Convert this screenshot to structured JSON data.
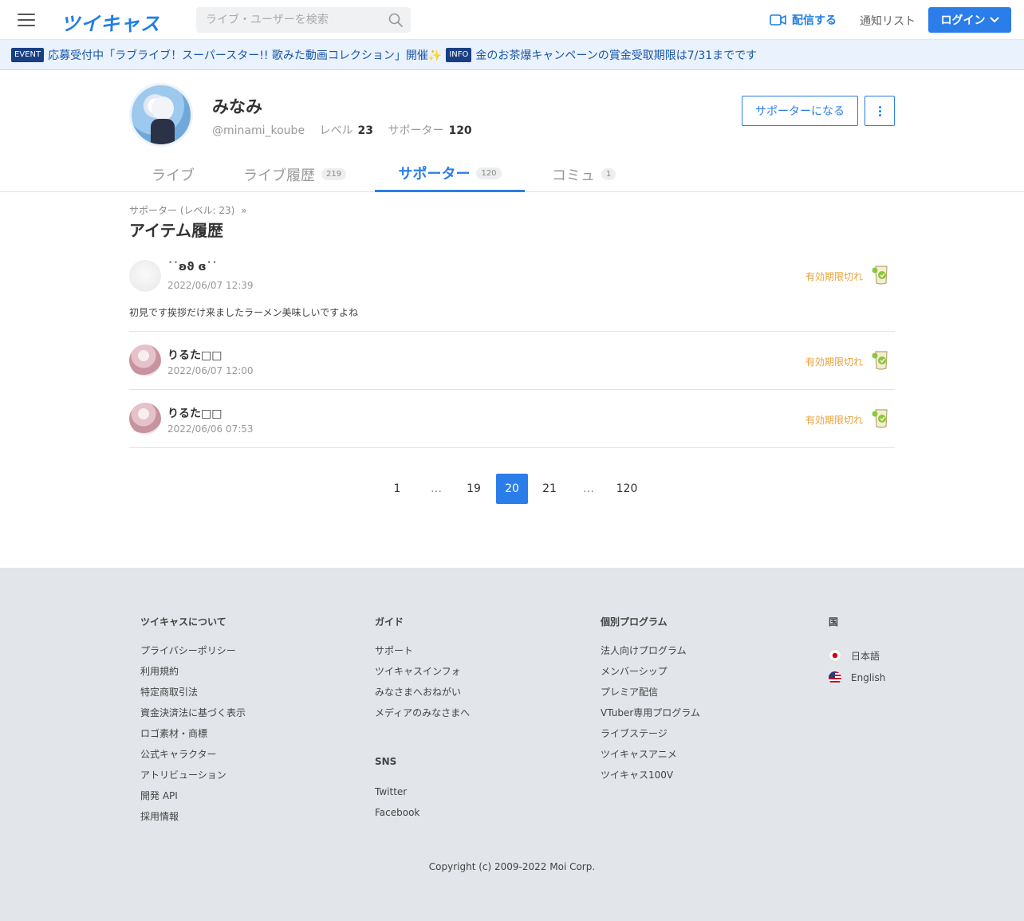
{
  "header": {
    "logo": "ツイキャス",
    "search_placeholder": "ライブ・ユーザーを検索",
    "broadcast_label": "配信する",
    "notify_label": "通知リスト",
    "login_label": "ログイン"
  },
  "infobar": {
    "event_tag": "EVENT",
    "event_text": "応募受付中「ラブライブ！スーパースター!! 歌みた動画コレクション」開催✨",
    "info_tag": "INFO",
    "info_text": "金のお茶爆キャンペーンの賞金受取期限は7/31までです"
  },
  "profile": {
    "name": "みなみ",
    "handle": "@minami_koube",
    "level_label": "レベル",
    "level_value": "23",
    "supporter_label": "サポーター",
    "supporter_value": "120",
    "become_supporter_label": "サポーターになる"
  },
  "tabs": [
    {
      "label": "ライブ",
      "count": ""
    },
    {
      "label": "ライブ履歴",
      "count": "219"
    },
    {
      "label": "サポーター",
      "count": "120"
    },
    {
      "label": "コミュ",
      "count": "1"
    }
  ],
  "content": {
    "breadcrumb": "サポーター (レベル: 23)",
    "breadcrumb_arrow": "»",
    "title": "アイテム履歴"
  },
  "items": [
    {
      "user": "˙˙ʚϑ ɞ˙˙",
      "date": "2022/06/07 12:39",
      "status": "有効期限切れ",
      "comment": "初見です挨拶だけ来ましたラーメン美味しいですよね"
    },
    {
      "user": "りるた□□",
      "date": "2022/06/07 12:00",
      "status": "有効期限切れ",
      "comment": ""
    },
    {
      "user": "りるた□□",
      "date": "2022/06/06 07:53",
      "status": "有効期限切れ",
      "comment": ""
    }
  ],
  "pagination": [
    "1",
    "…",
    "19",
    "20",
    "21",
    "…",
    "120"
  ],
  "pagination_current": "20",
  "footer": {
    "col1": {
      "heading": "ツイキャスについて",
      "links": [
        "プライバシーポリシー",
        "利用規約",
        "特定商取引法",
        "資金決済法に基づく表示",
        "ロゴ素材・商標",
        "公式キャラクター",
        "アトリビューション",
        "開発 API",
        "採用情報"
      ]
    },
    "col2": {
      "heading": "ガイド",
      "links": [
        "サポート",
        "ツイキャスインフォ",
        "みなさまへおねがい",
        "メディアのみなさまへ"
      ]
    },
    "col2_sns": {
      "heading": "SNS",
      "links": [
        "Twitter",
        "Facebook"
      ]
    },
    "col3": {
      "heading": "個別プログラム",
      "links": [
        "法人向けプログラム",
        "メンバーシップ",
        "プレミア配信",
        "VTuber専用プログラム",
        "ライブステージ",
        "ツイキャスアニメ",
        "ツイキャス100V"
      ]
    },
    "col4": {
      "heading": "国",
      "languages": [
        "日本語",
        "English"
      ]
    },
    "copyright": "Copyright (c) 2009-2022 Moi Corp."
  },
  "colors": {
    "accent": "#2b7de9",
    "expired": "#e6a23c",
    "footer_bg": "#e2e5e9",
    "infobar_bg": "#e9f2fd"
  }
}
